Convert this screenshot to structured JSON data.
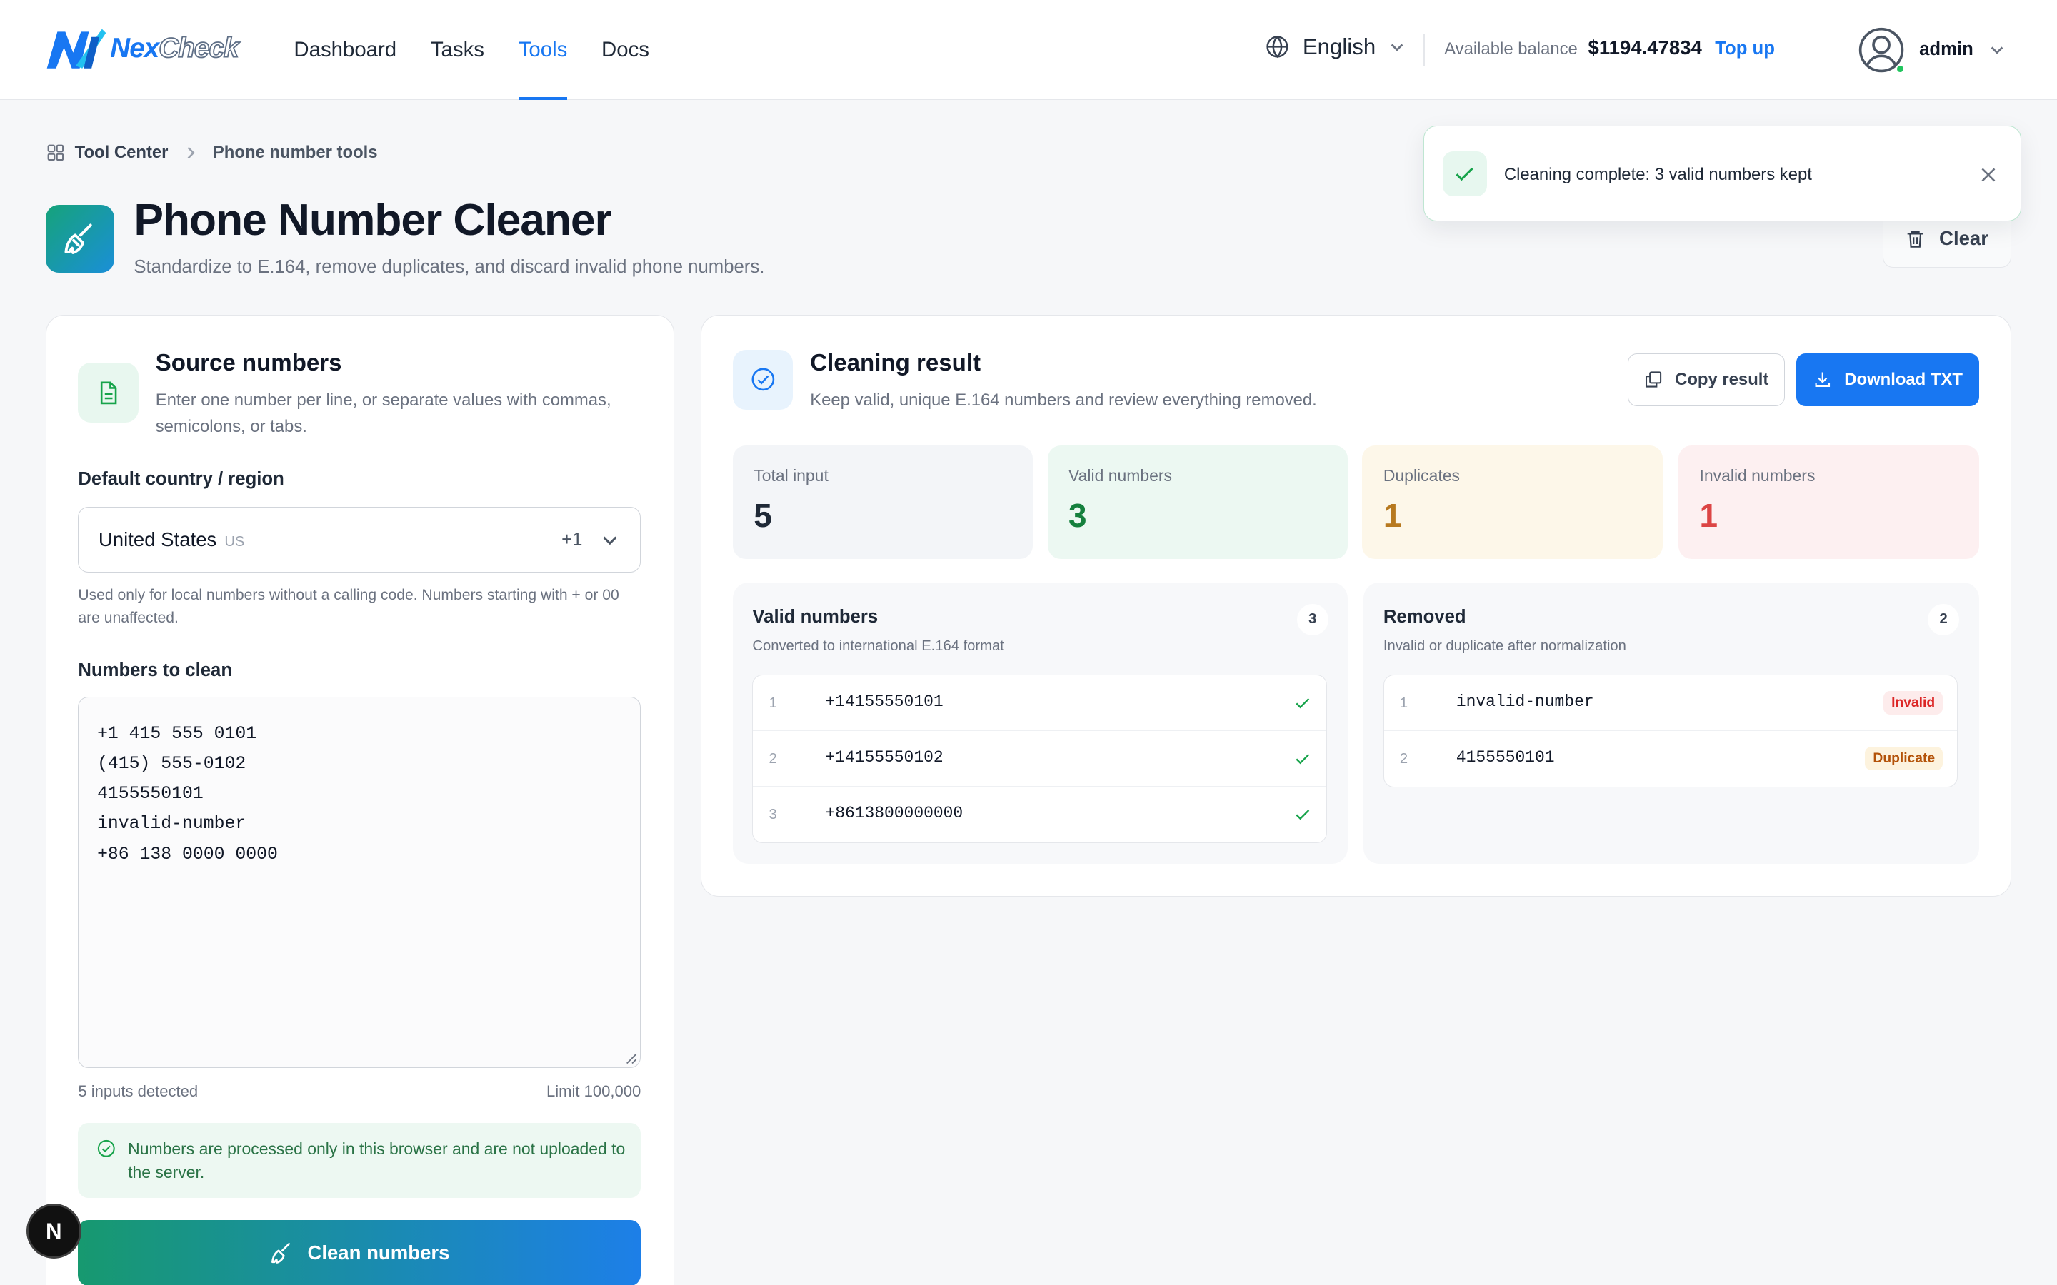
{
  "header": {
    "logo": {
      "nex": "Nex",
      "check": "Check"
    },
    "nav": [
      "Dashboard",
      "Tasks",
      "Tools",
      "Docs"
    ],
    "active_nav": "Tools",
    "language": "English",
    "balance_label": "Available balance",
    "balance_value": "$1194.47834",
    "topup_label": "Top up",
    "username": "admin"
  },
  "breadcrumb": {
    "home": "Tool Center",
    "current": "Phone number tools"
  },
  "page": {
    "title": "Phone Number Cleaner",
    "subtitle": "Standardize to E.164, remove duplicates, and discard invalid phone numbers.",
    "clear_label": "Clear"
  },
  "toast": {
    "message": "Cleaning complete: 3 valid numbers kept"
  },
  "source": {
    "title": "Source numbers",
    "desc": "Enter one number per line, or separate values with commas, semicolons, or tabs.",
    "country_label": "Default country / region",
    "country_name": "United States",
    "country_code": "US",
    "dial_code": "+1",
    "country_help": "Used only for local numbers without a calling code. Numbers starting with + or 00 are unaffected.",
    "numbers_label": "Numbers to clean",
    "numbers_value": "+1 415 555 0101\n(415) 555-0102\n4155550101\ninvalid-number\n+86 138 0000 0000",
    "inputs_detected": "5 inputs detected",
    "limit": "Limit 100,000",
    "privacy": "Numbers are processed only in this browser and are not uploaded to the server.",
    "clean_label": "Clean numbers"
  },
  "result": {
    "title": "Cleaning result",
    "desc": "Keep valid, unique E.164 numbers and review everything removed.",
    "copy_label": "Copy result",
    "download_label": "Download TXT",
    "stats": [
      {
        "label": "Total input",
        "value": "5",
        "bg": "#f3f5f8",
        "color": "#1f2937"
      },
      {
        "label": "Valid numbers",
        "value": "3",
        "bg": "#ecf8f2",
        "color": "#15803d"
      },
      {
        "label": "Duplicates",
        "value": "1",
        "bg": "#fdf7e9",
        "color": "#b7791f"
      },
      {
        "label": "Invalid numbers",
        "value": "1",
        "bg": "#fdf0f1",
        "color": "#dc4545"
      }
    ],
    "valid": {
      "title": "Valid numbers",
      "desc": "Converted to international E.164 format",
      "count": "3",
      "items": [
        {
          "idx": "1",
          "number": "+14155550101"
        },
        {
          "idx": "2",
          "number": "+14155550102"
        },
        {
          "idx": "3",
          "number": "+8613800000000"
        }
      ]
    },
    "removed": {
      "title": "Removed",
      "desc": "Invalid or duplicate after normalization",
      "count": "2",
      "items": [
        {
          "idx": "1",
          "number": "invalid-number",
          "tag": "Invalid",
          "kind": "invalid"
        },
        {
          "idx": "2",
          "number": "4155550101",
          "tag": "Duplicate",
          "kind": "duplicate"
        }
      ]
    }
  },
  "dev_badge": "N"
}
